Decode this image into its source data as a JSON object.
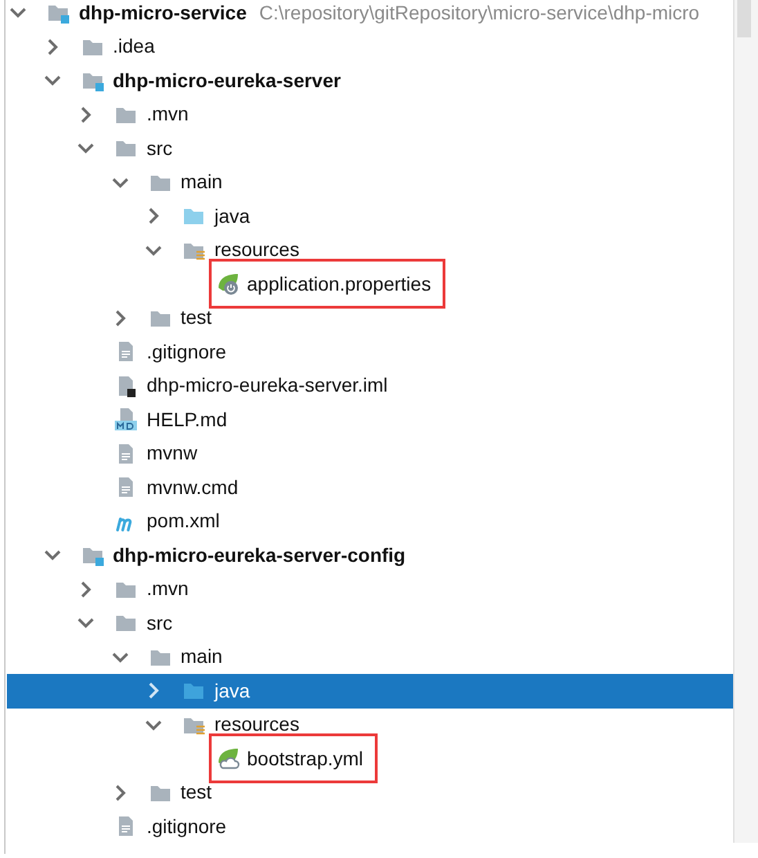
{
  "project_tree": [
    {
      "name": "dhp-micro-service",
      "path": "C:\\repository\\gitRepository\\micro-service\\dhp-micro",
      "kind": "module",
      "expanded": true,
      "selected": false,
      "highlighted": false,
      "children": [
        {
          "name": ".idea",
          "kind": "folder",
          "expanded": false,
          "selected": false,
          "highlighted": false
        },
        {
          "name": "dhp-micro-eureka-server",
          "kind": "module",
          "expanded": true,
          "selected": false,
          "highlighted": false,
          "children": [
            {
              "name": ".mvn",
              "kind": "folder",
              "expanded": false,
              "selected": false,
              "highlighted": false
            },
            {
              "name": "src",
              "kind": "folder",
              "expanded": true,
              "selected": false,
              "highlighted": false,
              "children": [
                {
                  "name": "main",
                  "kind": "folder",
                  "expanded": true,
                  "selected": false,
                  "highlighted": false,
                  "children": [
                    {
                      "name": "java",
                      "kind": "source",
                      "expanded": false,
                      "selected": false,
                      "highlighted": false
                    },
                    {
                      "name": "resources",
                      "kind": "resources",
                      "expanded": true,
                      "selected": false,
                      "highlighted": false,
                      "children": [
                        {
                          "name": "application.properties",
                          "kind": "spring",
                          "selected": false,
                          "highlighted": true
                        }
                      ]
                    }
                  ]
                },
                {
                  "name": "test",
                  "kind": "folder",
                  "expanded": false,
                  "selected": false,
                  "highlighted": false
                }
              ]
            },
            {
              "name": ".gitignore",
              "kind": "text",
              "selected": false,
              "highlighted": false
            },
            {
              "name": "dhp-micro-eureka-server.iml",
              "kind": "iml",
              "selected": false,
              "highlighted": false
            },
            {
              "name": "HELP.md",
              "kind": "markdown",
              "selected": false,
              "highlighted": false
            },
            {
              "name": "mvnw",
              "kind": "text",
              "selected": false,
              "highlighted": false
            },
            {
              "name": "mvnw.cmd",
              "kind": "text",
              "selected": false,
              "highlighted": false
            },
            {
              "name": "pom.xml",
              "kind": "maven",
              "selected": false,
              "highlighted": false
            }
          ]
        },
        {
          "name": "dhp-micro-eureka-server-config",
          "kind": "module",
          "expanded": true,
          "selected": false,
          "highlighted": false,
          "children": [
            {
              "name": ".mvn",
              "kind": "folder",
              "expanded": false,
              "selected": false,
              "highlighted": false
            },
            {
              "name": "src",
              "kind": "folder",
              "expanded": true,
              "selected": false,
              "highlighted": false,
              "children": [
                {
                  "name": "main",
                  "kind": "folder",
                  "expanded": true,
                  "selected": false,
                  "highlighted": false,
                  "children": [
                    {
                      "name": "java",
                      "kind": "source",
                      "expanded": false,
                      "selected": true,
                      "highlighted": false
                    },
                    {
                      "name": "resources",
                      "kind": "resources",
                      "expanded": true,
                      "selected": false,
                      "highlighted": false,
                      "children": [
                        {
                          "name": "bootstrap.yml",
                          "kind": "spring-cloud",
                          "selected": false,
                          "highlighted": true
                        }
                      ]
                    }
                  ]
                },
                {
                  "name": "test",
                  "kind": "folder",
                  "expanded": false,
                  "selected": false,
                  "highlighted": false
                }
              ]
            },
            {
              "name": ".gitignore",
              "kind": "text",
              "selected": false,
              "highlighted": false
            }
          ]
        }
      ]
    }
  ]
}
